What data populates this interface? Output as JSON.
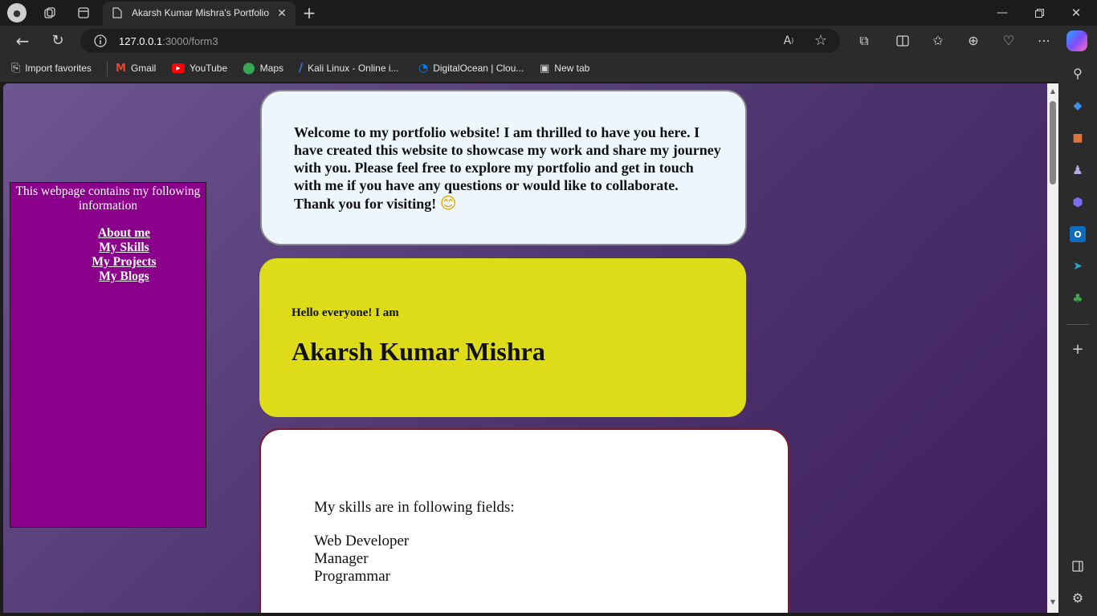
{
  "browser": {
    "tab_title": "Akarsh Kumar Mishra's Portfolio",
    "url_host": "127.0.0.1",
    "url_path": ":3000/form3",
    "favorites": [
      {
        "label": "Import favorites",
        "icon": "import-icon"
      },
      {
        "label": "Gmail",
        "icon": "gmail-icon"
      },
      {
        "label": "YouTube",
        "icon": "youtube-icon"
      },
      {
        "label": "Maps",
        "icon": "maps-icon"
      },
      {
        "label": "Kali Linux - Online i...",
        "icon": "kali-icon"
      },
      {
        "label": "DigitalOcean | Clou...",
        "icon": "digitalocean-icon"
      },
      {
        "label": "New tab",
        "icon": "new-tab-icon"
      }
    ]
  },
  "page": {
    "info_box": {
      "text": "This webpage contains my following information",
      "links": [
        "About me",
        "My Skills",
        "My Projects",
        "My Blogs"
      ]
    },
    "welcome": {
      "text": "Welcome to my portfolio website! I am thrilled to have you here. I have created this website to showcase my work and share my journey with you. Please feel free to explore my portfolio and get in touch with me if you have any questions or would like to collaborate. Thank you for visiting!",
      "emoji": "😊"
    },
    "hello": {
      "intro": "Hello everyone! I am",
      "name": "Akarsh Kumar Mishra"
    },
    "skills": {
      "heading": "My skills are in following fields:",
      "items": [
        "Web Developer",
        "Manager",
        "Programmar"
      ]
    }
  },
  "colors": {
    "info_box_bg": "#8b008b",
    "hello_bg": "#dedb18",
    "welcome_bg": "#edf5fd",
    "page_gradient_start": "#6e5690",
    "page_gradient_end": "#3e1e5c"
  }
}
